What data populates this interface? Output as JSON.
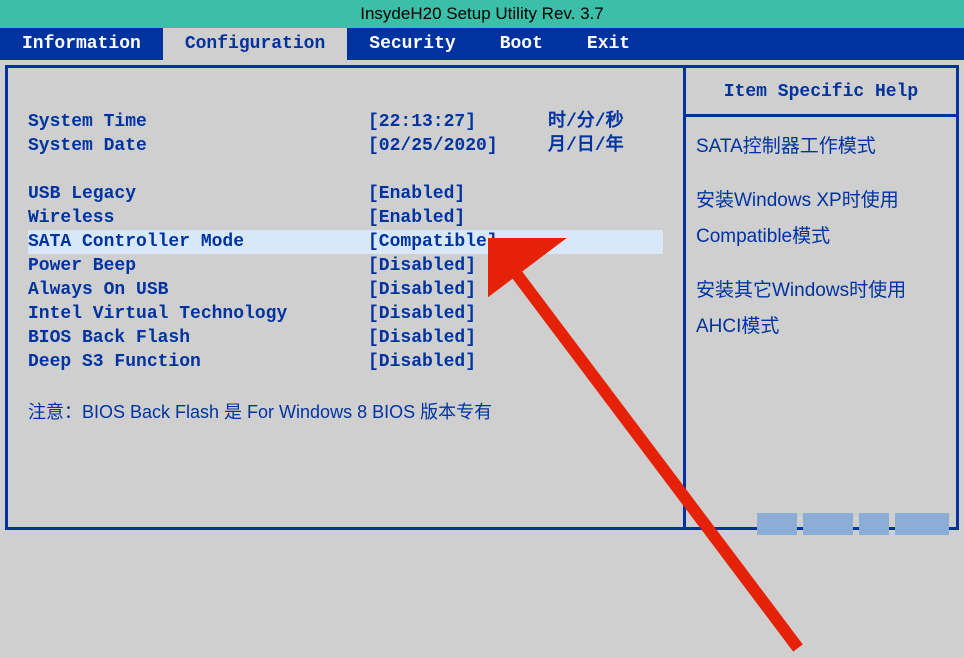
{
  "title": "InsydeH20 Setup Utility Rev. 3.7",
  "tabs": [
    {
      "label": "Information"
    },
    {
      "label": "Configuration"
    },
    {
      "label": "Security"
    },
    {
      "label": "Boot"
    },
    {
      "label": "Exit"
    }
  ],
  "settings": {
    "system_time": {
      "label": "System Time",
      "value": "[22:13:27]",
      "extra": "时/分/秒"
    },
    "system_date": {
      "label": "System Date",
      "value": "[02/25/2020]",
      "extra": "月/日/年"
    },
    "usb_legacy": {
      "label": "USB Legacy",
      "value": "[Enabled]"
    },
    "wireless": {
      "label": "Wireless",
      "value": "[Enabled]"
    },
    "sata_mode": {
      "label": "SATA Controller Mode",
      "value": "[Compatible]"
    },
    "power_beep": {
      "label": "Power Beep",
      "value": "[Disabled]"
    },
    "always_on_usb": {
      "label": "Always On USB",
      "value": "[Disabled]"
    },
    "intel_vt": {
      "label": "Intel Virtual Technology",
      "value": "[Disabled]"
    },
    "bios_back_flash": {
      "label": "BIOS Back Flash",
      "value": "[Disabled]"
    },
    "deep_s3": {
      "label": "Deep S3 Function",
      "value": "[Disabled]"
    }
  },
  "note": "注意：BIOS Back Flash 是 For Windows 8 BIOS 版本专有",
  "help": {
    "title": "Item Specific Help",
    "line1": "SATA控制器工作模式",
    "line2": "安装Windows XP时使用Compatible模式",
    "line3": "安装其它Windows时使用AHCI模式"
  }
}
